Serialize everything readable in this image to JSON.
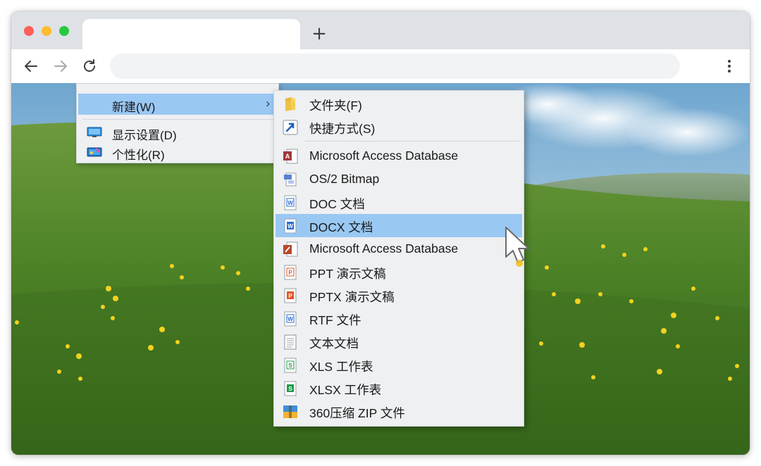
{
  "browser": {
    "new_tab_symbol": "+",
    "tab_title": "",
    "address": ""
  },
  "context_menu": {
    "items": [
      {
        "label": "新建(W)",
        "icon": "none",
        "highlighted": true,
        "has_submenu": true
      },
      {
        "label": "显示设置(D)",
        "icon": "display-settings-icon"
      },
      {
        "label": "个性化(R)",
        "icon": "personalize-icon"
      }
    ],
    "submenu_arrow": "›"
  },
  "new_submenu": {
    "items": [
      {
        "label": "文件夹(F)",
        "icon": "folder-icon"
      },
      {
        "label": "快捷方式(S)",
        "icon": "shortcut-icon"
      },
      {
        "label": "Microsoft Access Database",
        "icon": "access-icon"
      },
      {
        "label": "OS/2 Bitmap",
        "icon": "bitmap-icon"
      },
      {
        "label": "DOC 文档",
        "icon": "doc-icon"
      },
      {
        "label": "DOCX 文档",
        "icon": "docx-icon",
        "highlighted": true
      },
      {
        "label": "Microsoft Access Database",
        "icon": "access-red-icon"
      },
      {
        "label": "PPT 演示文稿",
        "icon": "ppt-icon"
      },
      {
        "label": "PPTX 演示文稿",
        "icon": "pptx-icon"
      },
      {
        "label": "RTF 文件",
        "icon": "rtf-icon"
      },
      {
        "label": "文本文档",
        "icon": "text-file-icon"
      },
      {
        "label": "XLS 工作表",
        "icon": "xls-icon"
      },
      {
        "label": "XLSX 工作表",
        "icon": "xlsx-icon"
      },
      {
        "label": "360压缩 ZIP 文件",
        "icon": "zip-archive-icon"
      }
    ]
  },
  "colors": {
    "highlight": "#99c8f3",
    "menu_bg": "#eef0f2",
    "word_blue": "#2b6bd1",
    "ppt_orange": "#e0572a",
    "excel_green": "#1f9a4c",
    "access_red": "#b7472a"
  }
}
